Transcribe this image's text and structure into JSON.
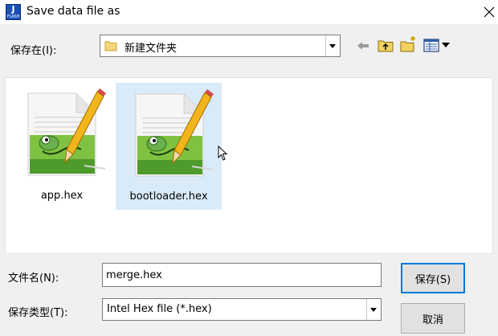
{
  "window": {
    "title": "Save data file as",
    "app_icon": {
      "top_text": "J",
      "bottom_text": "FLASH"
    },
    "close_icon": "close-icon"
  },
  "save_in": {
    "label": "保存在(I):",
    "path": "新建文件夹",
    "icons": [
      "folder-icon",
      "back-arrow-icon",
      "up-folder-icon",
      "new-folder-icon",
      "view-menu-icon"
    ]
  },
  "files": [
    {
      "name": "app.hex",
      "icon": "notepadpp-file-icon",
      "selected": false
    },
    {
      "name": "bootloader.hex",
      "icon": "notepadpp-file-icon",
      "selected": true
    }
  ],
  "filename": {
    "label": "文件名(N):",
    "value": "merge.hex"
  },
  "filetype": {
    "label": "保存类型(T):",
    "value": "Intel Hex file (*.hex)"
  },
  "buttons": {
    "save": "保存(S)",
    "cancel": "取消"
  },
  "colors": {
    "selection": "#d9ebf9",
    "default_button_border": "#0078d7"
  }
}
